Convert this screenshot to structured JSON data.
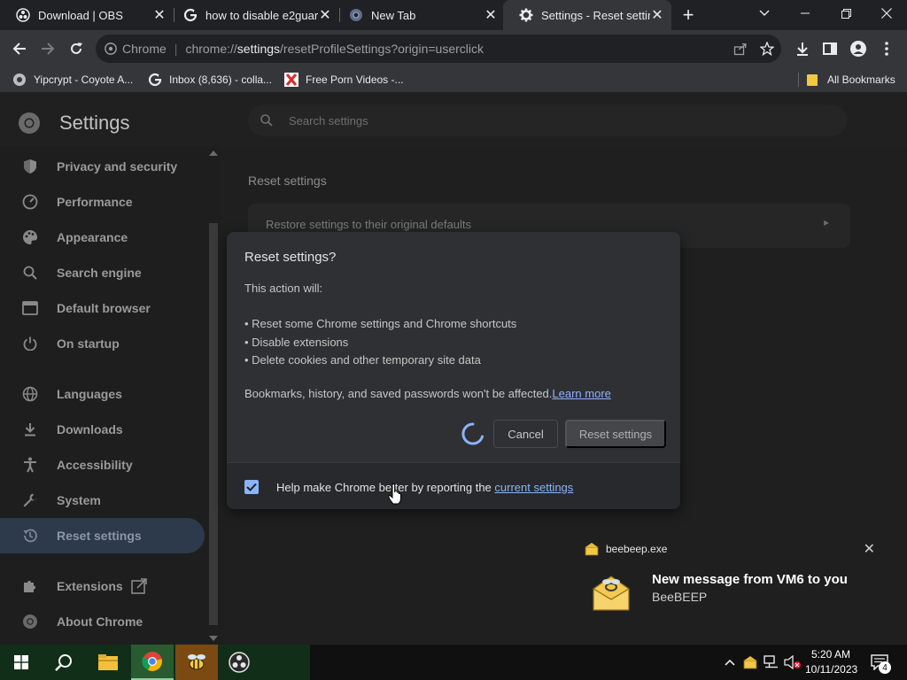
{
  "browser": {
    "tabs": [
      {
        "title": "Download | OBS",
        "icon": "obs-icon",
        "active": false
      },
      {
        "title": "how to disable e2guar",
        "icon": "google-icon",
        "active": false
      },
      {
        "title": "New Tab",
        "icon": "chrome-icon",
        "active": false
      },
      {
        "title": "Settings - Reset settings",
        "icon": "gear-icon",
        "active": true
      }
    ],
    "new_tab_symbol": "+",
    "omnibox": {
      "site_label": "Chrome",
      "url_prefix": "chrome://",
      "url_bold": "settings",
      "url_suffix": "/resetProfileSettings?origin=userclick"
    },
    "bookmarks": [
      {
        "label": "Yipcrypt - Coyote A...",
        "icon": "yipcrypt-icon"
      },
      {
        "label": "Inbox (8,636) - colla...",
        "icon": "google-icon"
      },
      {
        "label": "Free Porn Videos -...",
        "icon": "x-site-icon"
      }
    ],
    "all_bookmarks_label": "All Bookmarks"
  },
  "settings": {
    "title": "Settings",
    "search_placeholder": "Search settings",
    "nav": [
      {
        "label": "Privacy and security",
        "icon": "shield-icon"
      },
      {
        "label": "Performance",
        "icon": "speedometer-icon"
      },
      {
        "label": "Appearance",
        "icon": "palette-icon"
      },
      {
        "label": "Search engine",
        "icon": "search-icon"
      },
      {
        "label": "Default browser",
        "icon": "browser-window-icon"
      },
      {
        "label": "On startup",
        "icon": "power-icon"
      },
      {
        "label": "Languages",
        "icon": "globe-icon"
      },
      {
        "label": "Downloads",
        "icon": "download-icon"
      },
      {
        "label": "Accessibility",
        "icon": "accessibility-icon"
      },
      {
        "label": "System",
        "icon": "wrench-icon"
      },
      {
        "label": "Reset settings",
        "icon": "history-icon",
        "selected": true
      },
      {
        "label": "Extensions",
        "icon": "puzzle-icon"
      },
      {
        "label": "About Chrome",
        "icon": "chrome-icon"
      }
    ],
    "section_heading": "Reset settings",
    "restore_row": "Restore settings to their original defaults"
  },
  "dialog": {
    "title": "Reset settings?",
    "intro": "This action will:",
    "bullets": [
      "• Reset some Chrome settings and Chrome shortcuts",
      "• Disable extensions",
      "• Delete cookies and other temporary site data"
    ],
    "note": "Bookmarks, history, and saved passwords won't be affected.",
    "learn_more": "Learn more",
    "cancel_label": "Cancel",
    "reset_label": "Reset settings",
    "report_text": "Help make Chrome better by reporting the ",
    "report_link": "current settings",
    "report_checked": true
  },
  "toast": {
    "app_name": "beebeep.exe",
    "title": "New message from VM6 to you",
    "source": "BeeBEEP"
  },
  "taskbar": {
    "time": "5:20 AM",
    "date": "10/11/2023",
    "notification_count": "4"
  },
  "colors": {
    "accent": "#8ab4f8",
    "dialog_bg": "#2f3033",
    "selected_nav": "#2c3a4c"
  }
}
